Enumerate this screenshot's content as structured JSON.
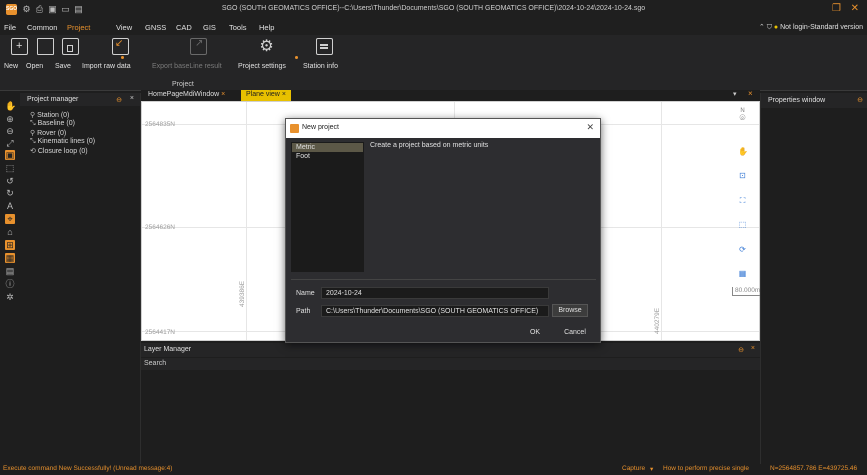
{
  "app": {
    "logo_text": "SGO",
    "title": "SGO (SOUTH GEOMATICS OFFICE)--C:\\Users\\Thunder\\Documents\\SGO (SOUTH GEOMATICS OFFICE)\\2024-10-24\\2024-10-24.sgo",
    "accent": "#e8912d"
  },
  "menu": [
    "File",
    "Common",
    "Project",
    "View",
    "GNSS",
    "CAD",
    "GIS",
    "Tools",
    "Help"
  ],
  "menu_active": "Project",
  "login_status": "Not login-Standard version",
  "ribbon": {
    "buttons": [
      {
        "label": "New",
        "icon": "new-icon"
      },
      {
        "label": "Open",
        "icon": "open-folder-icon"
      },
      {
        "label": "Save",
        "icon": "save-icon"
      },
      {
        "label": "Import raw data",
        "icon": "import-icon"
      },
      {
        "label": "Export baseLine result",
        "icon": "export-icon"
      },
      {
        "label": "Project settings",
        "icon": "settings-gear-icon"
      },
      {
        "label": "Station info",
        "icon": "document-icon"
      }
    ],
    "group_label": "Project"
  },
  "project_manager": {
    "title": "Project manager",
    "items": [
      "Station (0)",
      "Baseline (0)",
      "Rover (0)",
      "Kinematic lines (0)",
      "Closure loop (0)"
    ]
  },
  "tabs": [
    "HomePageMdiWindow",
    "Plane view"
  ],
  "plane_view": {
    "north_labels": [
      "2564835N",
      "2564626N",
      "2564417N"
    ],
    "east_labels": [
      "439386E",
      "440279E"
    ],
    "scale": "80.000m"
  },
  "properties": {
    "title": "Properties window"
  },
  "layer_manager": {
    "title": "Layer Manager",
    "search_label": "Search"
  },
  "dialog": {
    "title": "New project",
    "units": [
      "Metric",
      "Foot"
    ],
    "selected_unit": "Metric",
    "description": "Create a project based on metric units",
    "name_label": "Name",
    "name_value": "2024-10-24",
    "path_label": "Path",
    "path_value": "C:\\Users\\Thunder\\Documents\\SGO (SOUTH GEOMATICS OFFICE)",
    "browse": "Browse",
    "ok": "OK",
    "cancel": "Cancel"
  },
  "status": {
    "message": "Execute command New Successfully! (Unread message:4)",
    "capture": "Capture",
    "hint": "How to perform precise single",
    "coords": "N=2564857.786  E=439725.46"
  }
}
